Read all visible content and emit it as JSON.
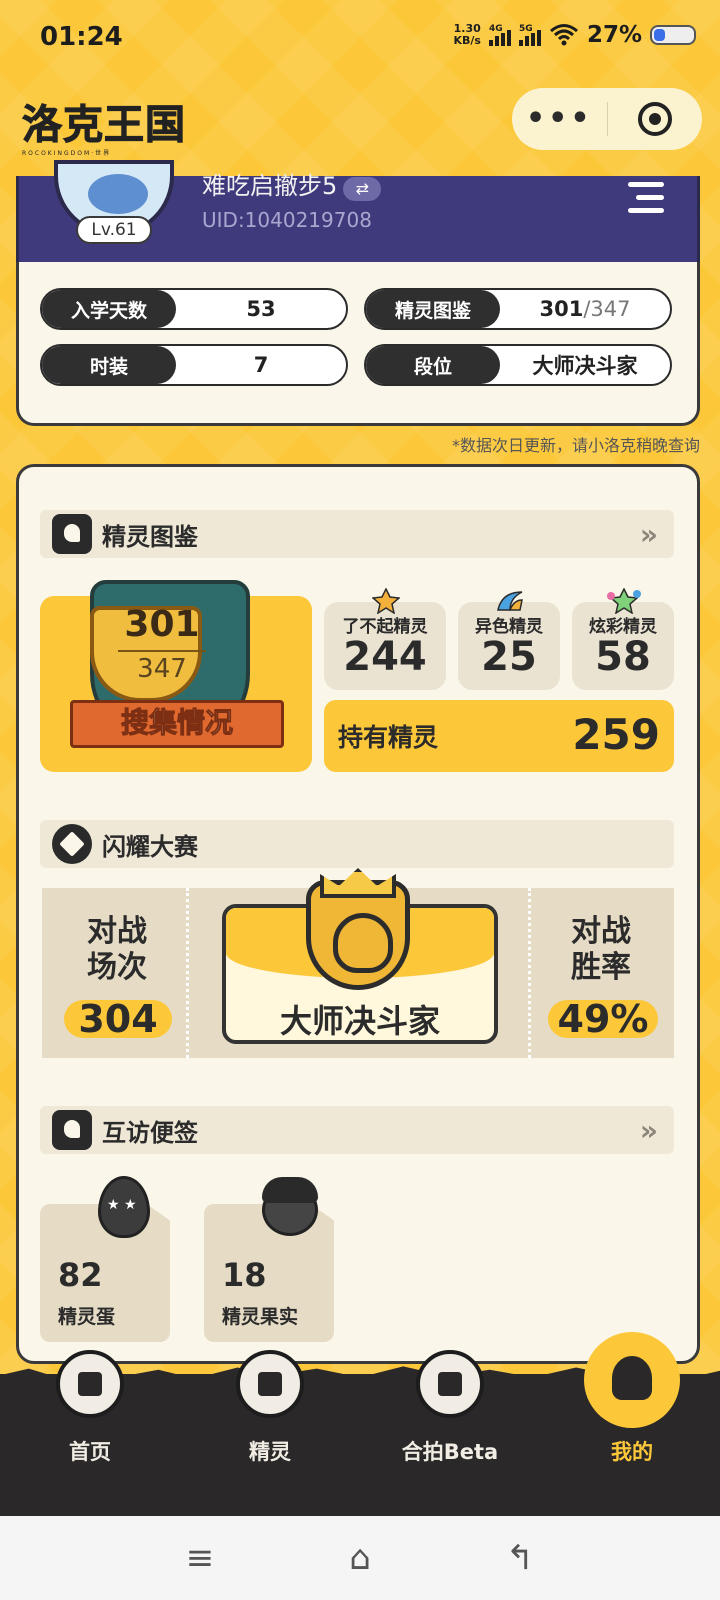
{
  "status_bar": {
    "time": "01:24",
    "net_speed_value": "1.30",
    "net_speed_unit": "KB/s",
    "sim1_label": "4G",
    "sim2_label": "5G",
    "battery": "27%",
    "battery_level": 0.27
  },
  "header": {
    "app_logo": "洛克王国",
    "app_logo_sub": "ROCOKINGDOM·世界",
    "capsule_more_icon": "more-dots-icon",
    "capsule_close_icon": "target-icon"
  },
  "profile": {
    "nickname": "难吃启撤步5",
    "swap_icon": "⇄",
    "uid": "UID:1040219708",
    "level": "Lv.61",
    "stats": [
      {
        "label": "入学天数",
        "value": "53",
        "value_extra": ""
      },
      {
        "label": "精灵图鉴",
        "value": "301",
        "value_extra": "/347"
      },
      {
        "label": "时装",
        "value": "7",
        "value_extra": ""
      },
      {
        "label": "段位",
        "value": "大师决斗家",
        "value_extra": ""
      }
    ],
    "note": "*数据次日更新，请小洛克稍晚查询"
  },
  "pokedex": {
    "title": "精灵图鉴",
    "more": "»",
    "collected": "301",
    "total": "347",
    "ribbon": "搜集情况",
    "categories": [
      {
        "label": "了不起精灵",
        "value": "244"
      },
      {
        "label": "异色精灵",
        "value": "25"
      },
      {
        "label": "炫彩精灵",
        "value": "58"
      }
    ],
    "owned_label": "持有精灵",
    "owned_value": "259"
  },
  "tournament": {
    "title": "闪耀大赛",
    "battles_label_1": "对战",
    "battles_label_2": "场次",
    "battles_value": "304",
    "rank": "大师决斗家",
    "winrate_label_1": "对战",
    "winrate_label_2": "胜率",
    "winrate_value": "49%"
  },
  "notes": {
    "title": "互访便签",
    "more": "»",
    "items": [
      {
        "value": "82",
        "label": "精灵蛋"
      },
      {
        "value": "18",
        "label": "精灵果实"
      }
    ]
  },
  "bottom_nav": {
    "items": [
      {
        "label": "首页",
        "icon": "home-icon"
      },
      {
        "label": "精灵",
        "icon": "backpack-icon"
      },
      {
        "label": "合拍Beta",
        "icon": "ai-photo-icon"
      },
      {
        "label": "我的",
        "icon": "profile-icon"
      }
    ],
    "active_index": 3
  },
  "system_nav": {
    "menu": "≡",
    "home": "⌂",
    "back": "↰"
  },
  "colors": {
    "background": "#fcc83a",
    "card": "#faf6ea",
    "profile_band": "#3f3a7c",
    "nav": "#2a2828"
  }
}
